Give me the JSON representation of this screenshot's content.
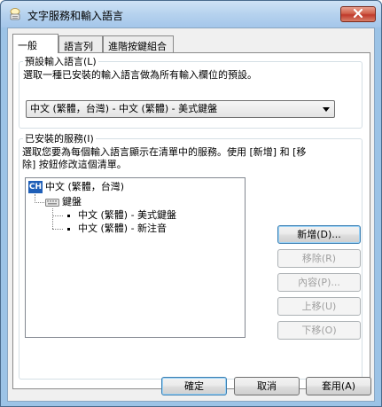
{
  "window": {
    "title": "文字服務和輸入語言",
    "app_icon": "text-services-icon",
    "close_icon": "close-icon"
  },
  "tabs": [
    {
      "label": "一般",
      "active": true
    },
    {
      "label": "語言列",
      "active": false
    },
    {
      "label": "進階按鍵組合",
      "active": false
    }
  ],
  "default_language": {
    "group_label": "預設輸入語言(L)",
    "description": "選取一種已安裝的輸入語言做為所有輸入欄位的預設。",
    "selected": "中文 (繁體，台灣) - 中文 (繁體) - 美式鍵盤"
  },
  "installed_services": {
    "group_label": "已安裝的服務(I)",
    "description_line1": "選取您要為每個輸入語言顯示在清單中的服務。使用 [新增] 和 [移",
    "description_line2": "除] 按鈕修改這個清單。",
    "tree": {
      "language_badge": "CH",
      "language": "中文 (繁體，台灣)",
      "category": "鍵盤",
      "category_icon": "keyboard-icon",
      "items": [
        "中文 (繁體) - 美式鍵盤",
        "中文 (繁體) - 新注音"
      ]
    },
    "buttons": {
      "add": "新增(D)...",
      "remove": "移除(R)",
      "properties": "內容(P)...",
      "move_up": "上移(U)",
      "move_down": "下移(O)"
    }
  },
  "footer": {
    "ok": "確定",
    "cancel": "取消",
    "apply": "套用(A)"
  },
  "colors": {
    "titlebar": "#b6d2ee",
    "close_button": "#c0392b",
    "language_badge": "#1f5fb8",
    "disabled_text": "#a0a0a0"
  }
}
